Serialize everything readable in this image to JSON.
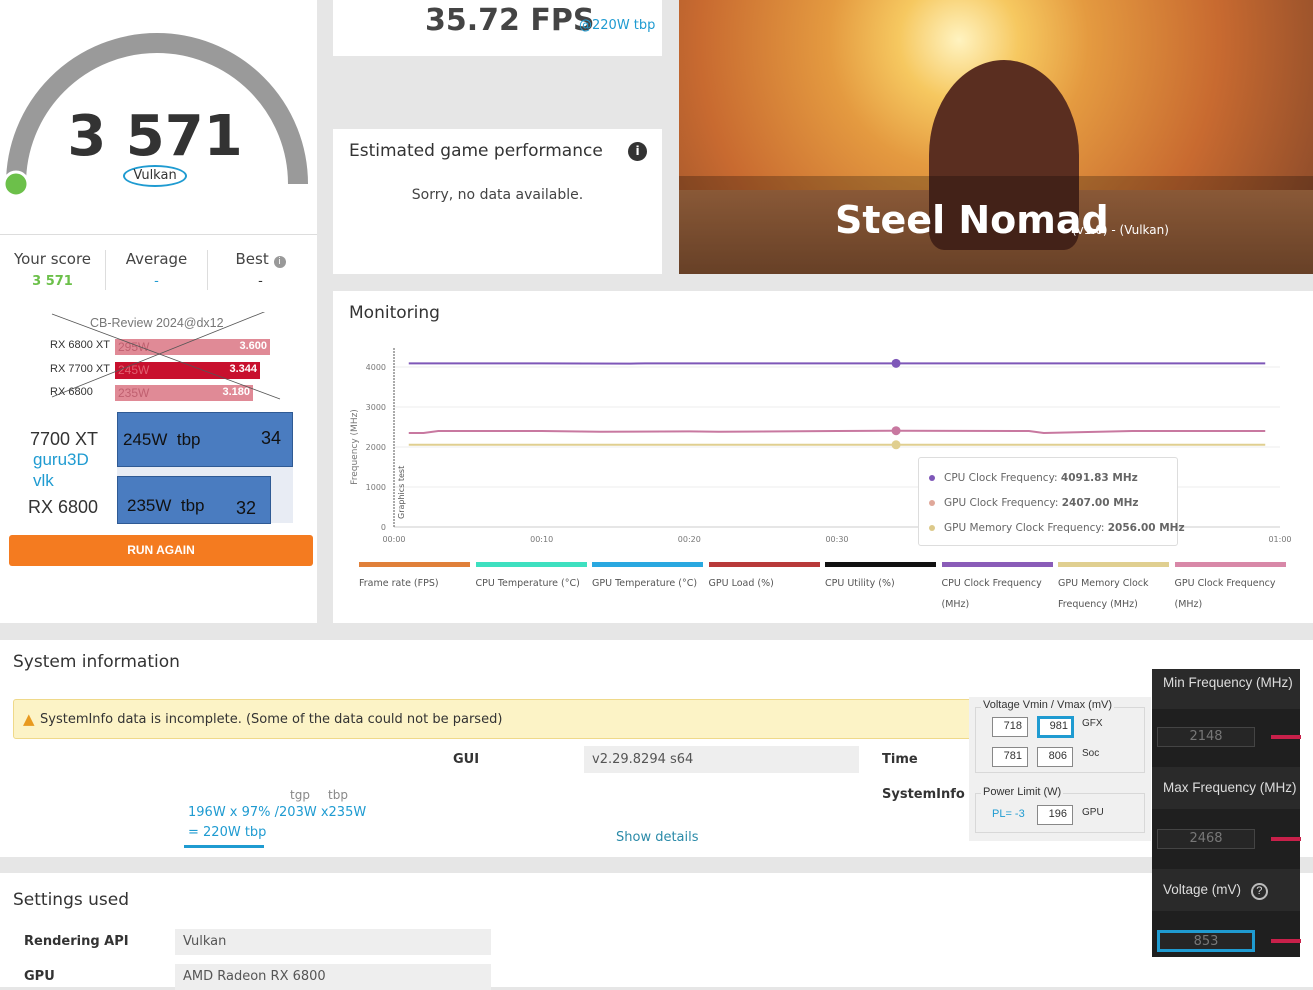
{
  "score": {
    "value": "3 571",
    "api": "Vulkan",
    "your_label": "Your score",
    "your_value": "3 571",
    "avg_label": "Average",
    "avg_value": "-",
    "best_label": "Best",
    "best_value": "-",
    "run_again": "RUN AGAIN"
  },
  "comparison": {
    "title": "CB-Review 2024@dx12",
    "rows": [
      {
        "name": "RX 6800 XT",
        "power": "295W",
        "value": "3.600"
      },
      {
        "name": "RX 7700 XT",
        "power": "245W",
        "value": "3.344"
      },
      {
        "name": "RX 6800",
        "power": "235W",
        "value": "3.180"
      }
    ],
    "guru": {
      "a_name": "7700 XT",
      "a_bar": "245W  tbp",
      "a_val": "34",
      "src1": "guru3D",
      "src2": "vlk",
      "b_name": "RX 6800",
      "b_bar": "235W  tbp",
      "b_val": "32"
    }
  },
  "fps": {
    "value": "35.72 FPS",
    "note": "@220W tbp"
  },
  "estimate": {
    "title": "Estimated game performance",
    "message": "Sorry, no data available."
  },
  "hero": {
    "title": "Steel Nomad",
    "sub": "(v1.0) - (Vulkan)"
  },
  "monitoring": {
    "title": "Monitoring",
    "marker": "Graphics test",
    "tooltip": [
      {
        "label": "CPU Clock Frequency: ",
        "value": "4091.83 MHz",
        "color": "#7e57b8"
      },
      {
        "label": "GPU Clock Frequency: ",
        "value": "2407.00 MHz",
        "color": "#e0a89a"
      },
      {
        "label": "GPU Memory Clock Frequency: ",
        "value": "2056.00 MHz",
        "color": "#dcc98a"
      }
    ],
    "legend": [
      {
        "label": "Frame rate (FPS)",
        "color": "#e0803a"
      },
      {
        "label": "CPU Temperature (°C)",
        "color": "#3ee0c0"
      },
      {
        "label": "GPU Temperature (°C)",
        "color": "#2aa8e0"
      },
      {
        "label": "GPU Load (%)",
        "color": "#b83a3a"
      },
      {
        "label": "CPU Utility (%)",
        "color": "#111111"
      },
      {
        "label": "CPU Clock Frequency (MHz)",
        "color": "#8a5cb8"
      },
      {
        "label": "GPU Memory Clock Frequency (MHz)",
        "color": "#e0cf90"
      },
      {
        "label": "GPU Clock Frequency (MHz)",
        "color": "#d888a8"
      }
    ]
  },
  "chart_data": {
    "type": "line",
    "ylabel": "Frequency (MHz)",
    "ylim": [
      0,
      4500
    ],
    "yticks": [
      0,
      1000,
      2000,
      3000,
      4000
    ],
    "xticks": [
      "00:00",
      "00:10",
      "00:20",
      "00:30",
      "01:00"
    ],
    "xlim_seconds": [
      0,
      60
    ],
    "series": [
      {
        "name": "CPU Clock Frequency",
        "color": "#7e57b8",
        "x": [
          1,
          10,
          16,
          17,
          20,
          30,
          34,
          59
        ],
        "y": [
          4090,
          4090,
          4085,
          4092,
          4090,
          4090,
          4091.83,
          4090
        ]
      },
      {
        "name": "GPU Clock Frequency",
        "color": "#c878a0",
        "x": [
          1,
          2,
          3,
          10,
          14,
          20,
          22,
          30,
          34,
          43,
          44,
          50,
          59
        ],
        "y": [
          2350,
          2350,
          2400,
          2400,
          2380,
          2390,
          2380,
          2400,
          2407,
          2400,
          2350,
          2400,
          2400
        ]
      },
      {
        "name": "GPU Memory Clock Frequency",
        "color": "#e0cf90",
        "x": [
          1,
          34,
          59
        ],
        "y": [
          2056,
          2056,
          2056
        ]
      }
    ],
    "hover_x": 34
  },
  "sysinfo": {
    "title": "System information",
    "warning": "SystemInfo data is incomplete. (Some of the data could not be parsed)",
    "gui_label": "GUI",
    "gui_value": "v2.29.8294 s64",
    "time_label": "Time",
    "sysinfo_label": "SystemInfo",
    "tgp": "tgp",
    "tbp": "tbp",
    "note1": "196W x 97% /203W x235W",
    "note2": "= 220W tbp",
    "show_details": "Show details"
  },
  "settings": {
    "title": "Settings used",
    "rows": [
      {
        "label": "Rendering API",
        "value": "Vulkan"
      },
      {
        "label": "GPU",
        "value": "AMD Radeon RX 6800"
      }
    ]
  },
  "tuning": {
    "voltage_title": "Voltage Vmin / Vmax (mV)",
    "gfx_min": "718",
    "gfx_max": "981",
    "gfx": "GFX",
    "soc_min": "781",
    "soc_max": "806",
    "soc": "Soc",
    "power_title": "Power Limit (W)",
    "pl": "PL= -3",
    "gpu_power": "196",
    "gpu": "GPU"
  },
  "adrenalin": {
    "min_label": "Min Frequency (MHz)",
    "min_value": "2148",
    "max_label": "Max Frequency (MHz)",
    "max_value": "2468",
    "volt_label": "Voltage (mV)",
    "volt_value": "853"
  }
}
